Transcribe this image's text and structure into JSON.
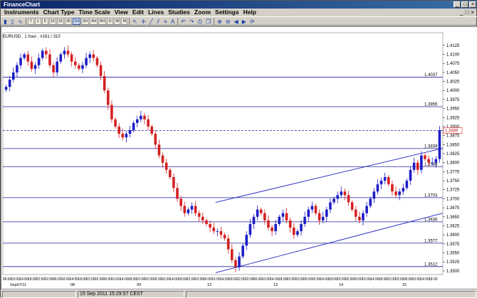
{
  "window": {
    "title": "FinanceChart",
    "controls": [
      "_",
      "□",
      "×"
    ]
  },
  "menu": {
    "items": [
      "Instruments",
      "Chart Type",
      "Time Scale",
      "View",
      "Edit",
      "Lines",
      "Studies",
      "Zoom",
      "Settings",
      "Help"
    ],
    "right": [
      "_",
      "□",
      "×"
    ]
  },
  "toolbar": {
    "timeframes": [
      "T",
      "1",
      "5",
      "10",
      "15",
      "30",
      "1H",
      "2H",
      "4H",
      "8H",
      "D",
      "W",
      "M"
    ],
    "active_timeframe": "1H",
    "icons": [
      "arrow-icon",
      "crosshair-icon",
      "line-icon",
      "channel-icon",
      "fib-icon",
      "text-icon",
      "undo-icon",
      "redo-icon",
      "print-icon",
      "copy-icon",
      "zoom-in-icon",
      "zoom-out-icon",
      "scroll-left-icon",
      "scroll-right-icon",
      "refresh-icon"
    ]
  },
  "chart": {
    "legend": "EURUSD , 1 hour , #161 / 310",
    "status": "15 Sep 2011 15:29:57 CEST",
    "date_label": "Sep07/11"
  },
  "chart_data": {
    "type": "candlestick",
    "symbol": "EURUSD",
    "timeframe": "1 hour",
    "ylim": [
      1.349,
      1.416
    ],
    "y_ticks": [
      "1.4125",
      "1.4100",
      "1.4075",
      "1.4050",
      "1.4025",
      "1.4000",
      "1.3975",
      "1.3950",
      "1.3925",
      "1.3900",
      "1.3875",
      "1.3850",
      "1.3825",
      "1.3800",
      "1.3775",
      "1.3750",
      "1.3725",
      "1.3700",
      "1.3675",
      "1.3650",
      "1.3625",
      "1.3600",
      "1.3575",
      "1.3550",
      "1.3525",
      "1.3500"
    ],
    "hlines": [
      {
        "value": 1.4037,
        "label": "1.4037"
      },
      {
        "value": 1.3955,
        "label": "1.3955"
      },
      {
        "value": 1.3839,
        "label": "1.3839"
      },
      {
        "value": 1.3789,
        "label": "1.3789"
      },
      {
        "value": 1.3703,
        "label": "1.3703"
      },
      {
        "value": 1.3636,
        "label": "1.3636"
      },
      {
        "value": 1.3577,
        "label": "1.3577"
      },
      {
        "value": 1.3512,
        "label": "1.3512"
      }
    ],
    "current_price": {
      "value": 1.3889,
      "label": "1.3889"
    },
    "x_ticks": [
      "06:00",
      "10:00",
      "14:00",
      "18:00",
      "22:00",
      "02:00",
      "06:00",
      "10:00",
      "14:00",
      "18:00",
      "22:00",
      "02:00",
      "06:00",
      "10:00",
      "14:00",
      "18:00",
      "22:00",
      "02:00",
      "06:00",
      "10:00",
      "14:00",
      "18:00",
      "22:00",
      "02:00",
      "06:00",
      "10:00",
      "14:00",
      "18:00",
      "22:00",
      "02:00",
      "06:00",
      "10:00",
      "14:00",
      "18:00",
      "22:00",
      "02:00",
      "06:00",
      "10:00",
      "14:00",
      "18:00",
      "22:00",
      "02:00",
      "06:00",
      "10:00",
      "14:00",
      "18:00",
      "22:00",
      "02:00",
      "06:00",
      "10:00",
      "14:00",
      "18:00"
    ],
    "day_labels": [
      "08",
      "09",
      "12",
      "13",
      "14",
      "15"
    ],
    "channel": {
      "upper": [
        [
          0,
          1.369
        ],
        [
          1,
          1.384
        ]
      ],
      "lower": [
        [
          0,
          1.3495
        ],
        [
          1,
          1.366
        ]
      ]
    },
    "closes": [
      1.401,
      1.403,
      1.405,
      1.407,
      1.409,
      1.41,
      1.408,
      1.406,
      1.407,
      1.409,
      1.411,
      1.41,
      1.407,
      1.405,
      1.408,
      1.41,
      1.411,
      1.41,
      1.408,
      1.407,
      1.406,
      1.407,
      1.409,
      1.41,
      1.409,
      1.407,
      1.404,
      1.4,
      1.396,
      1.392,
      1.39,
      1.388,
      1.387,
      1.388,
      1.389,
      1.391,
      1.392,
      1.393,
      1.392,
      1.39,
      1.388,
      1.385,
      1.382,
      1.38,
      1.378,
      1.376,
      1.373,
      1.37,
      1.368,
      1.366,
      1.367,
      1.368,
      1.366,
      1.365,
      1.364,
      1.363,
      1.362,
      1.361,
      1.361,
      1.36,
      1.359,
      1.356,
      1.353,
      1.351,
      1.354,
      1.357,
      1.36,
      1.363,
      1.365,
      1.367,
      1.366,
      1.364,
      1.362,
      1.361,
      1.363,
      1.365,
      1.366,
      1.364,
      1.362,
      1.36,
      1.361,
      1.363,
      1.365,
      1.367,
      1.368,
      1.366,
      1.364,
      1.365,
      1.367,
      1.369,
      1.37,
      1.371,
      1.372,
      1.371,
      1.369,
      1.367,
      1.365,
      1.364,
      1.366,
      1.368,
      1.37,
      1.372,
      1.374,
      1.375,
      1.376,
      1.374,
      1.372,
      1.371,
      1.372,
      1.373,
      1.375,
      1.378,
      1.38,
      1.378,
      1.382,
      1.381,
      1.38,
      1.38,
      1.381,
      1.389
    ]
  },
  "colors": {
    "up": "#1d1dc8",
    "down": "#d42020",
    "grid": "#2020a0",
    "channel": "#2020c0"
  }
}
